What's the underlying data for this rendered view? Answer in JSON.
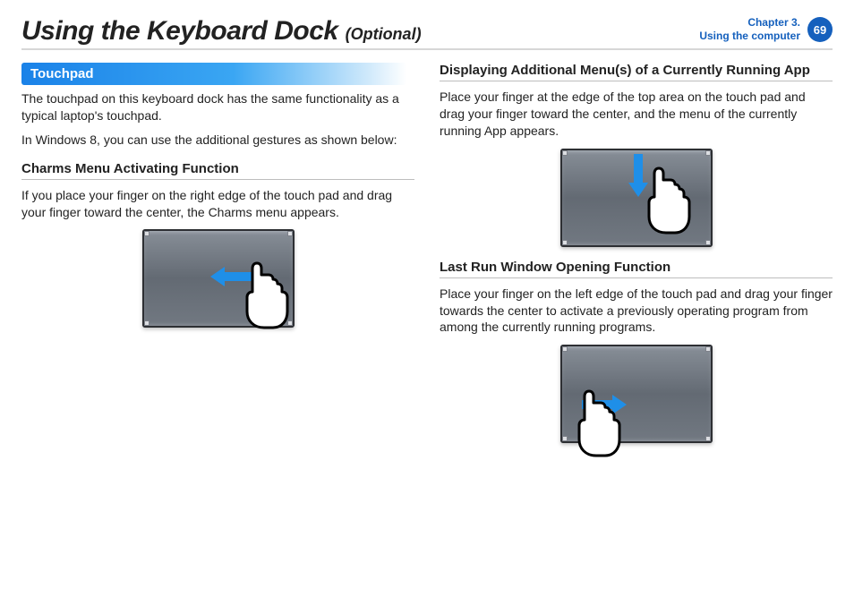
{
  "header": {
    "title": "Using the Keyboard Dock",
    "optional": "(Optional)",
    "chapter_line1": "Chapter 3.",
    "chapter_line2": "Using the computer",
    "page_number": "69"
  },
  "left": {
    "pill": "Touchpad",
    "intro1": "The touchpad on this keyboard dock has the same functionality as a typical laptop's touchpad.",
    "intro2": "In Windows 8, you can use the additional gestures as shown below:",
    "sec1_head": "Charms Menu Activating Function",
    "sec1_body": "If you place your finger on the right edge of the touch pad and drag your finger toward the center, the Charms menu appears."
  },
  "right": {
    "sec2_head": "Displaying Additional Menu(s) of a Currently Running App",
    "sec2_body": "Place your finger at the edge of the top area on the touch pad and drag your finger toward the center, and the menu of the currently running App appears.",
    "sec3_head": "Last Run Window Opening Function",
    "sec3_body": "Place your finger on the left edge of the touch pad and drag your finger towards the center to activate a previously operating program from among the currently running programs."
  },
  "icons": {
    "arrow_color": "#1f8fe8",
    "hand_name": "pointing-hand-icon",
    "pad_name": "touchpad-icon"
  }
}
